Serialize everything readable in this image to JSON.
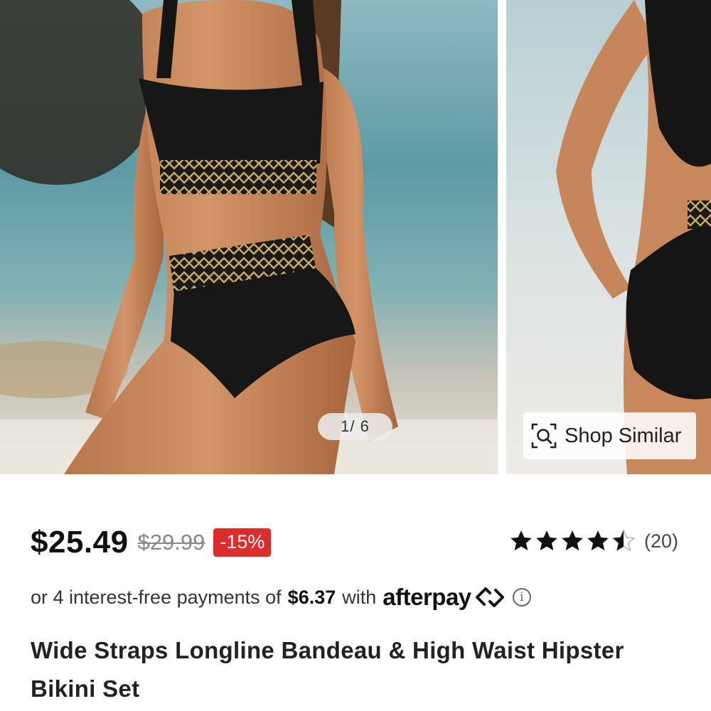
{
  "gallery": {
    "counter": "1/ 6",
    "shop_similar_label": "Shop Similar",
    "main_image_alt": "Model wearing black bikini with gold geometric trim on beach",
    "second_image_alt": "Back view of black bikini on beach"
  },
  "pricing": {
    "price": "$25.49",
    "original_price": "$29.99",
    "discount": "-15%"
  },
  "rating": {
    "value": 4.5,
    "count": "(20)"
  },
  "payment": {
    "prefix": "or 4 interest-free payments of",
    "amount": "$6.37",
    "with": "with",
    "provider": "afterpay"
  },
  "product": {
    "title": "Wide Straps Longline Bandeau & High Waist Hipster Bikini Set"
  },
  "colors": {
    "discount_bg": "#e02b2b",
    "text_primary": "#111111",
    "text_muted": "#888888"
  },
  "icons": [
    "search-lens-icon",
    "star-icon",
    "star-half-icon",
    "afterpay-loop-icon",
    "info-icon"
  ]
}
